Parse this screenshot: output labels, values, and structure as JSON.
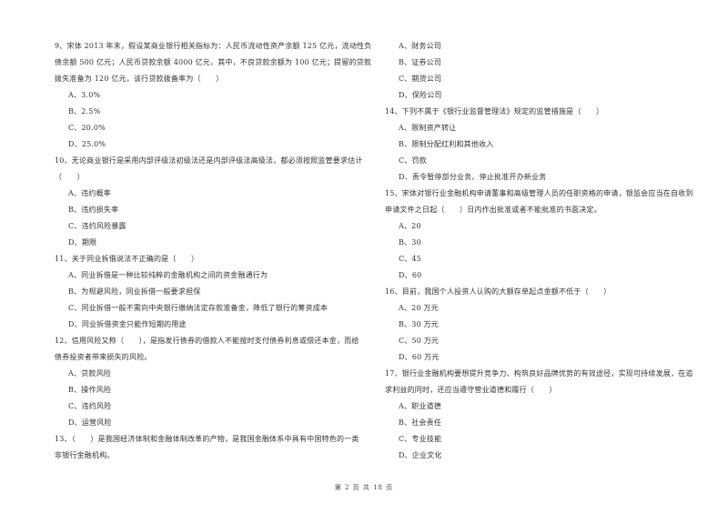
{
  "left_column": {
    "q9": {
      "lines": [
        "9、宋体 2013 年末，假设某商业银行相关指标为：人民币流动性资产余额 125 亿元，流动性负",
        "债余额 500 亿元；人民币贷款余额 4000 亿元，其中，不良贷款余额为 100 亿元；提留的贷款",
        "拨失准备为 120 亿元，该行贷款拨备率为（　　）"
      ],
      "options": [
        "A、3.0%",
        "B、2.5%",
        "C、20.0%",
        "D、25.0%"
      ]
    },
    "q10": {
      "lines": [
        "10、无论商业银行是采用内部评级法初级法还是内部评级法高级法，都必须按照监管要求估计",
        "（　　）"
      ],
      "options": [
        "A、违约概率",
        "B、违约损失率",
        "C、违约风险暴露",
        "D、期限"
      ]
    },
    "q11": {
      "lines": [
        "11、关于同业拆借说法不正确的是（　　）"
      ],
      "options": [
        "A、同业拆借是一种比较纯粹的金融机构之间的资金融通行为",
        "B、为规避风险，同业拆借一般要求担保",
        "C、同业拆借一般不需向中央银行缴纳法定存款准备金，降低了银行的筹资成本",
        "D、同业拆借资金只能作短期的用途"
      ]
    },
    "q12": {
      "lines": [
        "12、信用风险又称（　　），是指发行债券的借款人不能按时支付债券利息或偿还本金，而给",
        "债券投资者带来损失的风险。"
      ],
      "options": [
        "A、贷款风险",
        "B、操作风险",
        "C、违约风险",
        "D、运营风险"
      ]
    },
    "q13": {
      "lines": [
        "13、（　　）是我国经济体制和金融体制改革的产物，是我国金融体系中具有中国特色的一类",
        "非银行金融机构。"
      ]
    }
  },
  "right_column": {
    "q13_options": [
      "A、财务公司",
      "B、证券公司",
      "C、期货公司",
      "D、保险公司"
    ],
    "q14": {
      "lines": [
        "14、下列不属于《银行业监督管理法》规定的监管措施是（　　）"
      ],
      "options": [
        "A、限制资产转让",
        "B、限制分配红利和其他收入",
        "C、罚款",
        "D、责令暂停部分业务、停止批准开办新业务"
      ]
    },
    "q15": {
      "lines": [
        "15、宋体对银行业金融机构申请董事和高级管理人员的任职资格的申请，银监会应当在自收到",
        "申请文件之日起（　　）日内作出批准或者不能批准的书面决定。"
      ],
      "options": [
        "A、20",
        "B、30",
        "C、45",
        "D、60"
      ]
    },
    "q16": {
      "lines": [
        "16、目前，我国个人投资人认购的大额存单起点金额不低于（　　）"
      ],
      "options": [
        "A、20 万元",
        "B、30 万元",
        "C、50 万元",
        "D、60 万元"
      ]
    },
    "q17": {
      "lines": [
        "17、银行业金融机构要想提升竞争力、构筑良好品牌优势的有效途径，实现可持续发展，在追",
        "求利益的同时，还应当遵守营业道德和履行（　　）"
      ],
      "options": [
        "A、职业道德",
        "B、社会责任",
        "C、专业技能",
        "D、企业文化"
      ]
    }
  },
  "footer": {
    "page_label": "第 2 页 共 18 页"
  }
}
